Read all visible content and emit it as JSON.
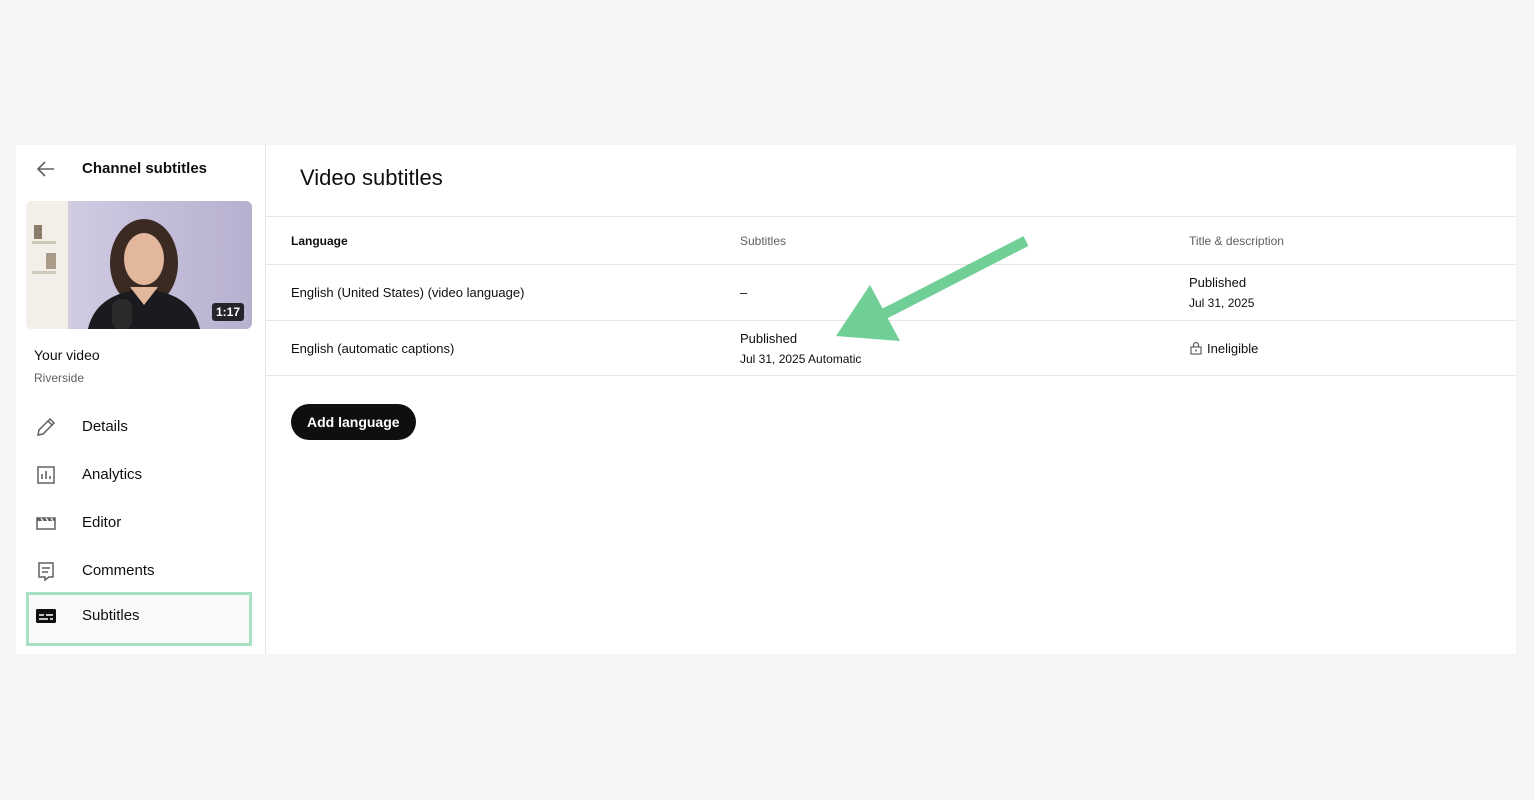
{
  "sidebar": {
    "back_icon": "arrow-left-icon",
    "title": "Channel subtitles",
    "video": {
      "duration": "1:17",
      "title": "Your video",
      "channel": "Riverside"
    },
    "items": [
      {
        "label": "Details",
        "icon": "pencil-icon"
      },
      {
        "label": "Analytics",
        "icon": "analytics-icon"
      },
      {
        "label": "Editor",
        "icon": "clapperboard-icon"
      },
      {
        "label": "Comments",
        "icon": "comment-icon"
      },
      {
        "label": "Subtitles",
        "icon": "subtitles-icon",
        "active": true
      }
    ]
  },
  "main": {
    "title": "Video subtitles",
    "columns": [
      "Language",
      "Subtitles",
      "Title & description"
    ],
    "rows": [
      {
        "language": "English (United States) (video language)",
        "subtitles_status": "–",
        "subtitles_detail": "",
        "title_status": "Published",
        "title_detail": "Jul 31, 2025"
      },
      {
        "language": "English (automatic captions)",
        "subtitles_status": "Published",
        "subtitles_detail": "Jul 31, 2025 Automatic",
        "title_status": "Ineligible",
        "title_detail": ""
      }
    ],
    "add_button": "Add language"
  },
  "colors": {
    "highlight": "#a8e0c4",
    "annotation_arrow": "#6fcf97",
    "button": "#0f0f0f"
  }
}
